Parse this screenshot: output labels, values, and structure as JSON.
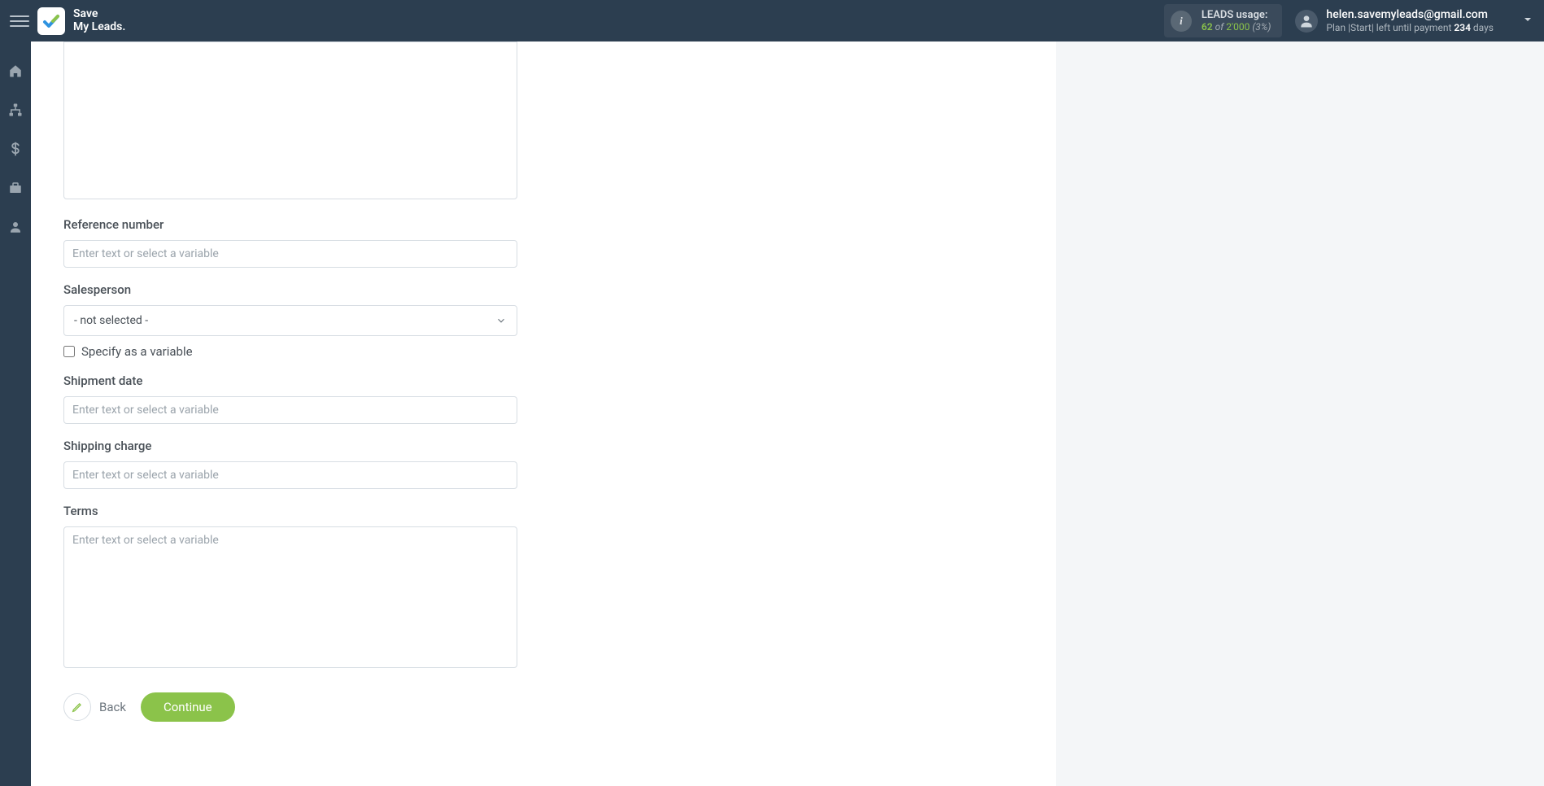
{
  "header": {
    "logo_line1": "Save",
    "logo_line2": "My Leads.",
    "leads_label": "LEADS usage:",
    "leads_used": "62",
    "leads_of": "of",
    "leads_limit": "2'000",
    "leads_pct": "(3%)",
    "user_email": "helen.savemyleads@gmail.com",
    "plan_prefix": "Plan |Start| left until payment ",
    "plan_days_value": "234",
    "plan_days_suffix": " days"
  },
  "form": {
    "top_textarea_placeholder": "",
    "reference_number": {
      "label": "Reference number",
      "placeholder": "Enter text or select a variable"
    },
    "salesperson": {
      "label": "Salesperson",
      "selected": "- not selected -",
      "specify_variable_label": "Specify as a variable"
    },
    "shipment_date": {
      "label": "Shipment date",
      "placeholder": "Enter text or select a variable"
    },
    "shipping_charge": {
      "label": "Shipping charge",
      "placeholder": "Enter text or select a variable"
    },
    "terms": {
      "label": "Terms",
      "placeholder": "Enter text or select a variable"
    }
  },
  "buttons": {
    "back": "Back",
    "continue": "Continue"
  }
}
